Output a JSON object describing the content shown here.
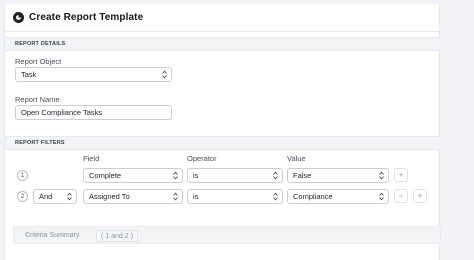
{
  "header": {
    "title": "Create Report Template",
    "icon": "report-icon"
  },
  "details": {
    "section_title": "REPORT DETAILS",
    "object_label": "Report Object",
    "object_value": "Task",
    "name_label": "Report Name",
    "name_value": "Open Compliance Tasks"
  },
  "filters": {
    "section_title": "REPORT FILTERS",
    "columns": {
      "field": "Field",
      "operator": "Operator",
      "value": "Value"
    },
    "rows": [
      {
        "num": "1",
        "conjunction": "",
        "field": "Complete",
        "operator": "is",
        "value": "False"
      },
      {
        "num": "2",
        "conjunction": "And",
        "field": "Assigned To",
        "operator": "is",
        "value": "Compliance"
      }
    ],
    "add_symbol": "+",
    "remove_symbol": "−"
  },
  "summary": {
    "label": "Criteria Summary",
    "value": "( 1 and 2 )"
  },
  "colors": {
    "accent": "#222222",
    "border": "#c9ced6",
    "muted": "#8a919b"
  }
}
